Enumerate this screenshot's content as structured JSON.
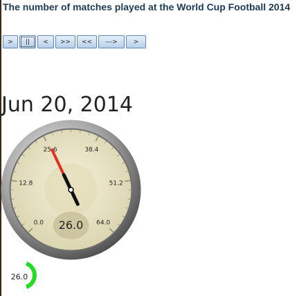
{
  "title": "The number of matches played at the World Cup Football 2014",
  "controls": [
    {
      "name": "play-button",
      "label": ">"
    },
    {
      "name": "pause-button",
      "label": "||",
      "pressed": true
    },
    {
      "name": "step-back-button",
      "label": "<"
    },
    {
      "name": "fast-forward-button",
      "label": ">>"
    },
    {
      "name": "rewind-button",
      "label": "<<"
    },
    {
      "name": "loop-button",
      "label": "--->"
    },
    {
      "name": "step-forward-button",
      "label": ">"
    }
  ],
  "date": "Jun 20, 2014",
  "gauge": {
    "min": 0.0,
    "max": 64.0,
    "value": 26.0,
    "value_label": "26.0",
    "ticks": [
      "0.0",
      "12.8",
      "25.6",
      "38.4",
      "51.2",
      "64.0"
    ],
    "needle_color": "#e53020",
    "face_color": "#ebe6c5"
  },
  "mini_gauge": {
    "value_label": "26.0",
    "arc_color": "#22dd22"
  }
}
